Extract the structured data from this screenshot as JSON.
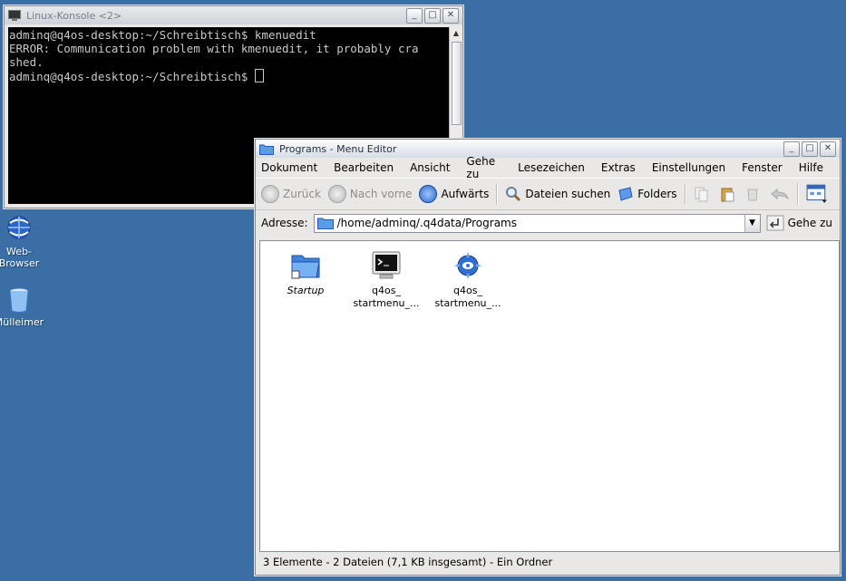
{
  "desktop": {
    "icons": [
      {
        "label": "Web-\nBrowser",
        "line1": "Web-",
        "line2": "Browser"
      },
      {
        "label": "Mülleimer"
      }
    ]
  },
  "console": {
    "title": "Linux-Konsole <2>",
    "lines": [
      "adminq@q4os-desktop:~/Schreibtisch$ kmenuedit",
      "ERROR: Communication problem with kmenuedit, it probably cra",
      "shed.",
      "adminq@q4os-desktop:~/Schreibtisch$ "
    ]
  },
  "konqueror": {
    "title": "Programs - Menu Editor",
    "menu": [
      "Dokument",
      "Bearbeiten",
      "Ansicht",
      "Gehe zu",
      "Lesezeichen",
      "Extras",
      "Einstellungen",
      "Fenster",
      "Hilfe"
    ],
    "toolbar": {
      "back": "Zurück",
      "forward": "Nach vorne",
      "up": "Aufwärts",
      "find": "Dateien suchen",
      "folders": "Folders"
    },
    "address": {
      "label": "Adresse:",
      "value": "/home/adminq/.q4data/Programs",
      "go": "Gehe zu"
    },
    "files": [
      {
        "name": "Startup",
        "icon": "folder-icon"
      },
      {
        "name1": "q4os_",
        "name2": "startmenu_...",
        "icon": "terminal-icon"
      },
      {
        "name1": "q4os_",
        "name2": "startmenu_...",
        "icon": "kde-gear-icon"
      }
    ],
    "status": "3 Elemente - 2 Dateien (7,1 KB insgesamt) - Ein Ordner"
  }
}
